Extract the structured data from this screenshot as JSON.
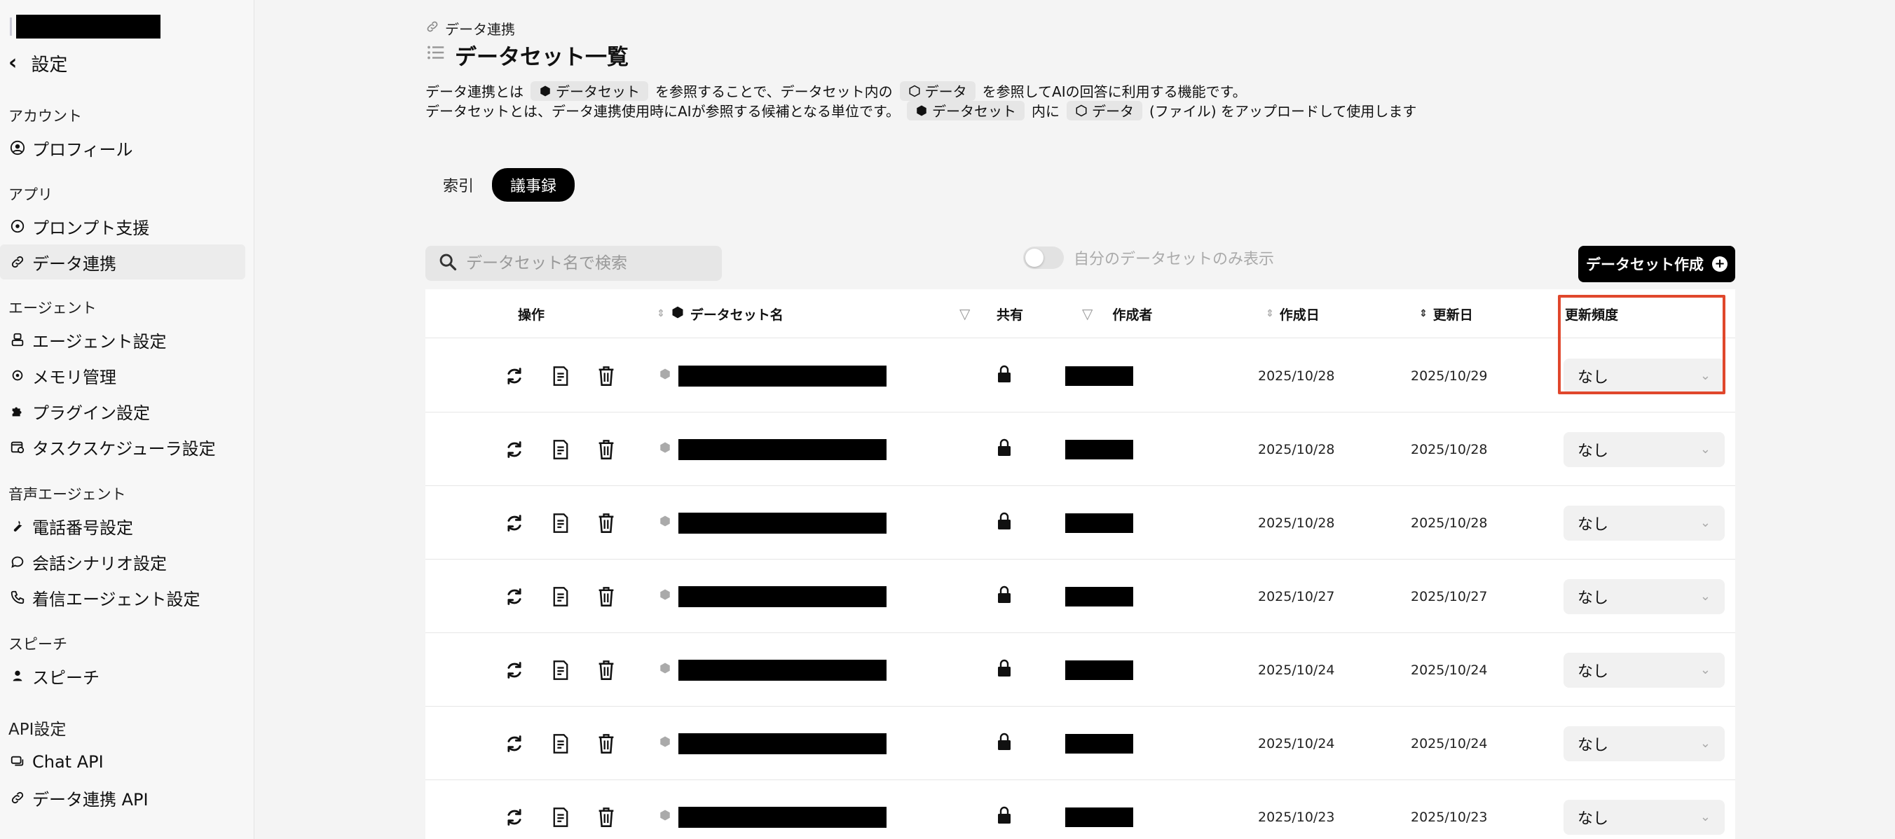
{
  "sidebar": {
    "back_label": "設定",
    "sections": [
      {
        "label": "アカウント",
        "items": [
          {
            "label": "プロフィール",
            "icon": "user-circle-icon"
          }
        ]
      },
      {
        "label": "アプリ",
        "items": [
          {
            "label": "プロンプト支援",
            "icon": "prompt-icon"
          },
          {
            "label": "データ連携",
            "icon": "link-icon",
            "active": true
          }
        ]
      },
      {
        "label": "エージェント",
        "items": [
          {
            "label": "エージェント設定",
            "icon": "agent-icon"
          },
          {
            "label": "メモリ管理",
            "icon": "memory-icon"
          },
          {
            "label": "プラグイン設定",
            "icon": "puzzle-icon"
          },
          {
            "label": "タスクスケジューラ設定",
            "icon": "calendar-clock-icon"
          }
        ]
      },
      {
        "label": "音声エージェント",
        "items": [
          {
            "label": "電話番号設定",
            "icon": "wrench-icon"
          },
          {
            "label": "会話シナリオ設定",
            "icon": "chat-bubble-icon"
          },
          {
            "label": "着信エージェント設定",
            "icon": "phone-icon"
          }
        ]
      },
      {
        "label": "スピーチ",
        "items": [
          {
            "label": "スピーチ",
            "icon": "speech-icon"
          }
        ]
      },
      {
        "label": "API設定",
        "items": [
          {
            "label": "Chat API",
            "icon": "chat-api-icon"
          },
          {
            "label": "データ連携 API",
            "icon": "link-icon"
          }
        ]
      }
    ]
  },
  "breadcrumb": "データ連携",
  "page_title": "データセット一覧",
  "description": {
    "line1": {
      "a": "データ連携とは",
      "chip1": "データセット",
      "b": "を参照することで、データセット内の",
      "chip2": "データ",
      "c": "を参照してAIの回答に利用する機能です。"
    },
    "line2": {
      "a": "データセットとは、データ連携使用時にAIが参照する候補となる単位です。",
      "chip1": "データセット",
      "b": "内に",
      "chip2": "データ",
      "c": "(ファイル) をアップロードして使用します"
    }
  },
  "tabs": [
    {
      "label": "索引",
      "active": false
    },
    {
      "label": "議事録",
      "active": true
    }
  ],
  "search": {
    "placeholder": "データセット名で検索"
  },
  "toggle": {
    "label": "自分のデータセットのみ表示",
    "on": false
  },
  "create_button": {
    "label": "データセット作成"
  },
  "table": {
    "headers": {
      "actions": "操作",
      "name": "データセット名",
      "share": "共有",
      "author": "作成者",
      "created": "作成日",
      "updated": "更新日",
      "frequency": "更新頻度"
    },
    "rows": [
      {
        "created": "2025/10/28",
        "updated": "2025/10/29",
        "frequency": "なし"
      },
      {
        "created": "2025/10/28",
        "updated": "2025/10/28",
        "frequency": "なし"
      },
      {
        "created": "2025/10/28",
        "updated": "2025/10/28",
        "frequency": "なし"
      },
      {
        "created": "2025/10/27",
        "updated": "2025/10/27",
        "frequency": "なし"
      },
      {
        "created": "2025/10/24",
        "updated": "2025/10/24",
        "frequency": "なし"
      },
      {
        "created": "2025/10/24",
        "updated": "2025/10/24",
        "frequency": "なし"
      },
      {
        "created": "2025/10/23",
        "updated": "2025/10/23",
        "frequency": "なし"
      }
    ]
  },
  "colors": {
    "highlight": "#e0472c",
    "primary_button": "#000000"
  }
}
